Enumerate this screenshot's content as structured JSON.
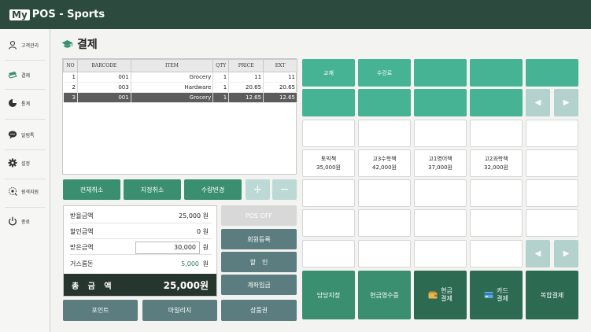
{
  "app": {
    "logo_box": "My",
    "logo_text": "POS - Sports"
  },
  "sidebar": {
    "items": [
      {
        "label": "고객관리",
        "icon": "user-icon"
      },
      {
        "label": "결제",
        "icon": "money-icon"
      },
      {
        "label": "통계",
        "icon": "pie-chart-icon"
      },
      {
        "label": "알림톡",
        "icon": "chat-icon"
      },
      {
        "label": "설정",
        "icon": "gear-icon"
      },
      {
        "label": "원격지원",
        "icon": "remote-icon"
      },
      {
        "label": "종료",
        "icon": "power-icon"
      }
    ]
  },
  "page": {
    "title": "결제"
  },
  "table": {
    "headers": [
      "NO",
      "BARCODE",
      "ITEM",
      "QTY",
      "PRICE",
      "EXT"
    ],
    "rows": [
      {
        "no": "1",
        "barcode": "001",
        "item": "Grocery",
        "qty": "1",
        "price": "11",
        "ext": "11"
      },
      {
        "no": "2",
        "barcode": "003",
        "item": "Hardware",
        "qty": "1",
        "price": "20.65",
        "ext": "20.65"
      },
      {
        "no": "3",
        "barcode": "001",
        "item": "Grocery",
        "qty": "1",
        "price": "12.65",
        "ext": "12.65"
      }
    ],
    "selected_row": 3
  },
  "actions": {
    "cancel_all": "전체취소",
    "cancel_selected": "지정취소",
    "change_qty": "수량변경",
    "plus": "+",
    "minus": "−"
  },
  "summary": {
    "receivable_label": "받을금액",
    "receivable_value": "25,000 원",
    "discount_label": "할인금액",
    "discount_value": "0 원",
    "received_label": "받은금액",
    "received_value": "30,000",
    "received_unit": "원",
    "change_label": "거스름돈",
    "change_value": "5,000",
    "change_unit": "원",
    "total_label": "총 금 액",
    "total_value": "25,000원"
  },
  "mid_buttons": {
    "pos_off": "POS OFF",
    "member_register": "회원등록",
    "discount": "할　인",
    "account_deposit": "계좌입금",
    "gift_card": "상품권"
  },
  "bottom_left": {
    "point": "포인트",
    "mileage": "마일리지"
  },
  "categories": {
    "textbook": "교재",
    "tuition": "수강료"
  },
  "products": [
    {
      "name": "토익책",
      "price": "35,000원"
    },
    {
      "name": "고3수학책",
      "price": "42,000원"
    },
    {
      "name": "고1영어책",
      "price": "37,000원"
    },
    {
      "name": "고2과학책",
      "price": "32,000원"
    }
  ],
  "pay": {
    "assign_staff": "담당지정",
    "cash_receipt": "현금영수증",
    "cash_pay_1": "현금",
    "cash_pay_2": "결제",
    "card_pay_1": "카드",
    "card_pay_2": "결제",
    "combined_pay": "복합결제"
  },
  "colors": {
    "header": "#2c4a3e",
    "teal": "#46b394",
    "green": "#3a8f70",
    "dark_green": "#2c6b52",
    "slate": "#5b7d7f",
    "accent_text": "#2a7a5e"
  }
}
